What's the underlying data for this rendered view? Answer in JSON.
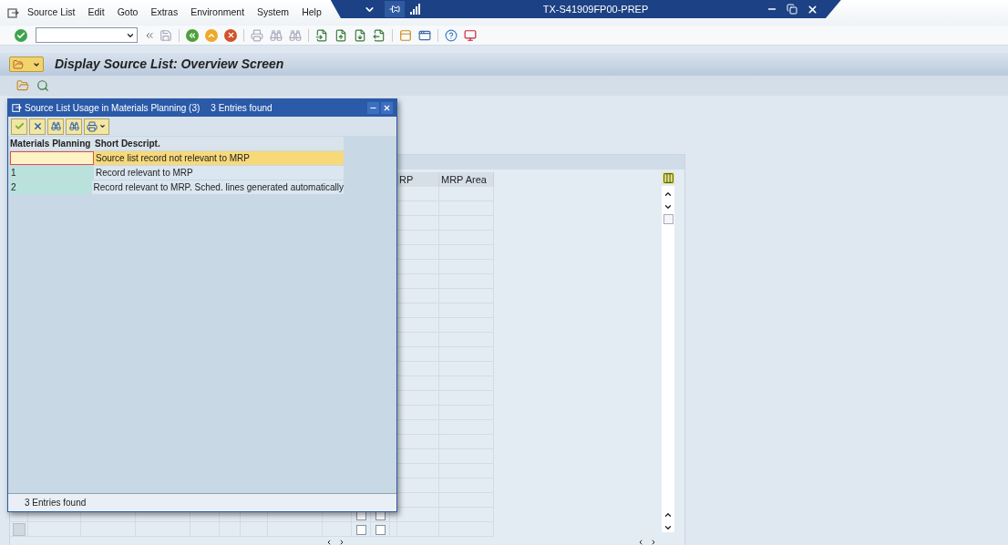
{
  "menu_bar": {
    "items": [
      "Source List",
      "Edit",
      "Goto",
      "Extras",
      "Environment",
      "System",
      "Help"
    ]
  },
  "system_title": "TX-S41909FP00-PREP",
  "screen_title": "Display Source List: Overview Screen",
  "table": {
    "columns": [
      "RP",
      "MRP Area"
    ],
    "rows": [
      {
        "checks": [
          {
            "checked": false
          },
          {
            "checked": false
          }
        ]
      },
      {
        "checks": [
          {
            "checked": false
          },
          {
            "checked": false
          }
        ]
      }
    ]
  },
  "dialog": {
    "title": "Source List Usage in Materials Planning (3)",
    "subtitle": "3 Entries found",
    "columns": [
      "Materials Planning",
      "Short Descript."
    ],
    "rows": [
      {
        "text": "Source list record not relevant to MRP",
        "selected": true
      },
      {
        "key": "1",
        "text": "Record relevant to MRP",
        "selected": false
      },
      {
        "key": "2",
        "text": "Record relevant to MRP. Sched. lines generated automatically",
        "selected": false
      }
    ],
    "status": "3 Entries found"
  }
}
